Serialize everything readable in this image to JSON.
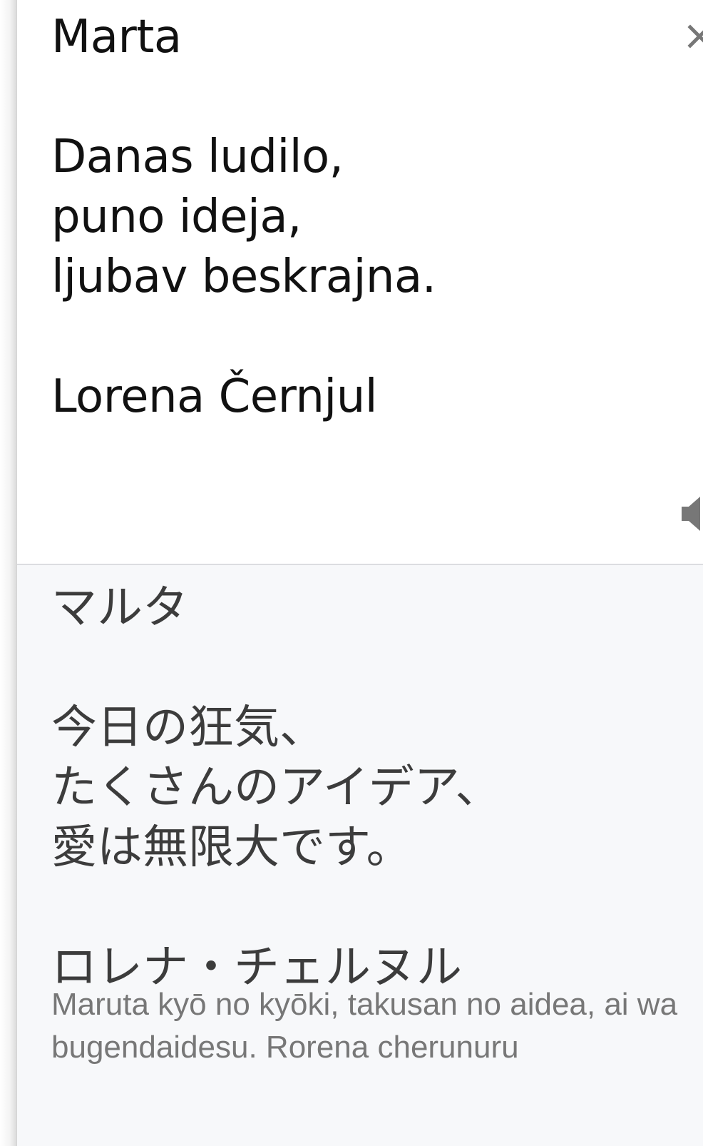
{
  "source": {
    "text": "Marta\n\nDanas ludilo,\npuno ideja,\nljubav beskrajna.\n\nLorena Černjul",
    "close_icon": "close-icon",
    "speaker_icon": "speaker-icon"
  },
  "translation": {
    "text": "マルタ\n\n今日の狂気、\nたくさんのアイデア、\n愛は無限大です。\n\nロレナ・チェルヌル",
    "romanization": "Maruta kyō no kyōki, takusan no aidea, ai wa bugendaidesu. Rorena cherunuru"
  },
  "colors": {
    "source_background": "#ffffff",
    "translation_background": "#f7f8fa",
    "source_text": "#111111",
    "translation_text": "#3c3c3c",
    "romanization_text": "#777777",
    "icon": "#777777"
  }
}
